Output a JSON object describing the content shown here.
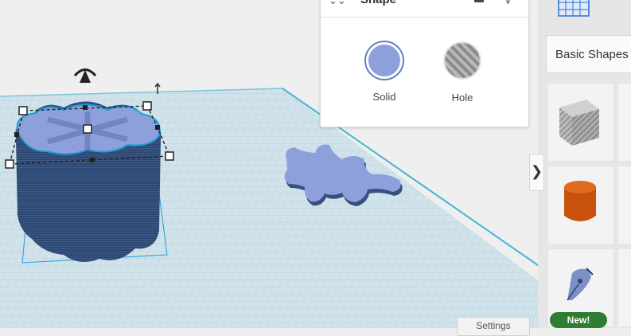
{
  "inspector": {
    "title": "Shape",
    "options": [
      {
        "label": "Solid",
        "selected": true,
        "color": "#8ea0dc"
      },
      {
        "label": "Hole",
        "selected": false
      }
    ]
  },
  "sidebar": {
    "library_selected": "Basic Shapes",
    "tiles": [
      {
        "name": "Box",
        "icon": "striped-cube-icon"
      },
      {
        "name": "Cylinder",
        "icon": "orange-cylinder-icon"
      },
      {
        "name": "Scribble",
        "icon": "pen-nib-icon",
        "badge": "New!"
      }
    ]
  },
  "collapse_toggle": "❯",
  "settings_label": "Settings",
  "colors": {
    "workplane": "#c9dde6",
    "workplane_edge": "#44b4d2",
    "extruded_shape": "#2d4670",
    "shape_top": "#8ea0dc",
    "selection": "#1aa0d8",
    "badge_green": "#2f7d32"
  }
}
